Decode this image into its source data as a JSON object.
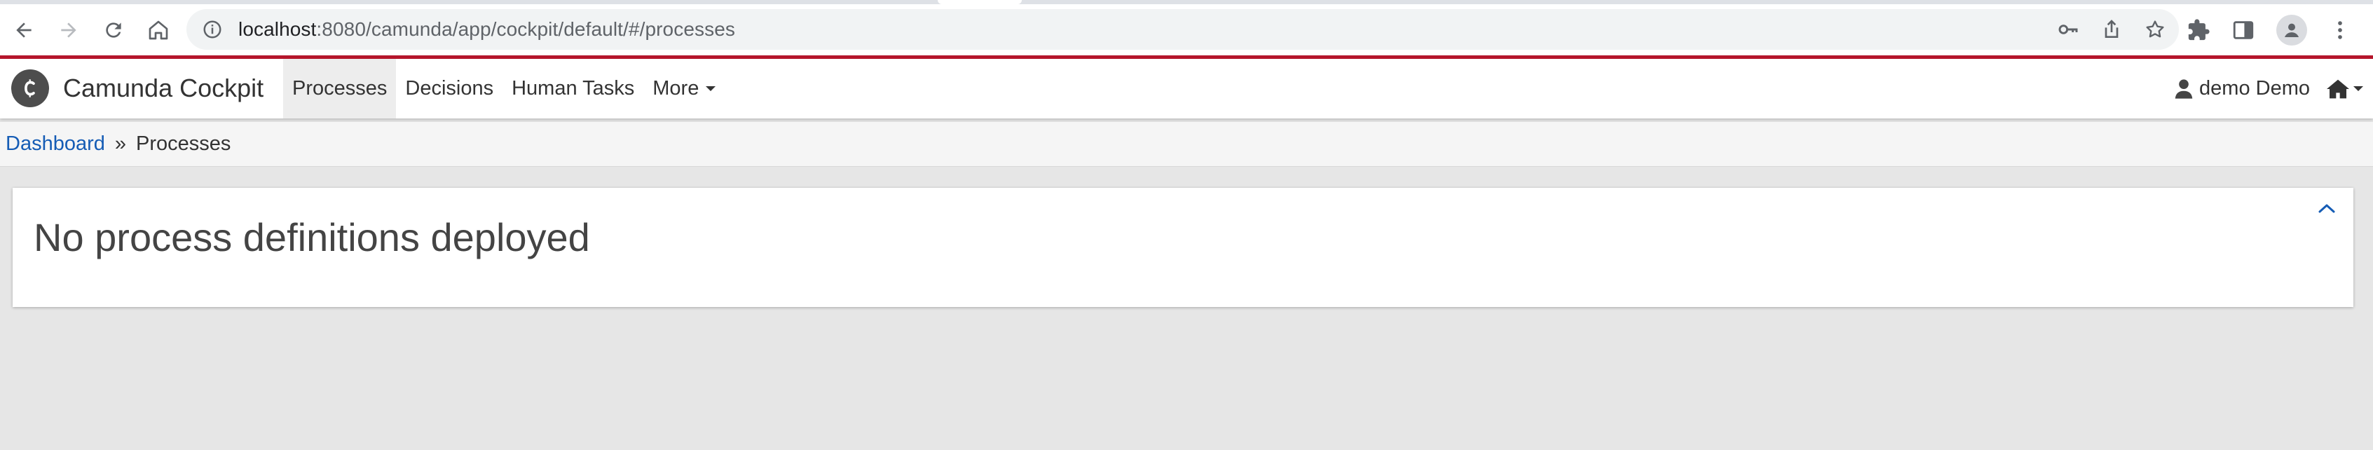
{
  "browser": {
    "url_host": "localhost",
    "url_path": ":8080/camunda/app/cockpit/default/#/processes",
    "icons": {
      "back": "arrow-left-icon",
      "forward": "arrow-right-icon",
      "reload": "reload-icon",
      "home": "home-icon",
      "site_info": "info-circle-icon",
      "password": "key-icon",
      "share": "share-icon",
      "bookmark": "star-icon",
      "extensions": "puzzle-icon",
      "side_panel": "side-panel-icon",
      "profile": "avatar-icon",
      "menu": "kebab-menu-icon"
    }
  },
  "app": {
    "brand_name": "Camunda Cockpit",
    "brand_color": "#b5152b",
    "nav": [
      {
        "label": "Processes",
        "active": true
      },
      {
        "label": "Decisions",
        "active": false
      },
      {
        "label": "Human Tasks",
        "active": false
      },
      {
        "label": "More",
        "active": false
      }
    ],
    "user_label": "demo Demo"
  },
  "breadcrumb": {
    "dashboard": "Dashboard",
    "separator": "»",
    "current": "Processes",
    "link_color": "#155cb5"
  },
  "panel": {
    "title": "No process definitions deployed"
  }
}
